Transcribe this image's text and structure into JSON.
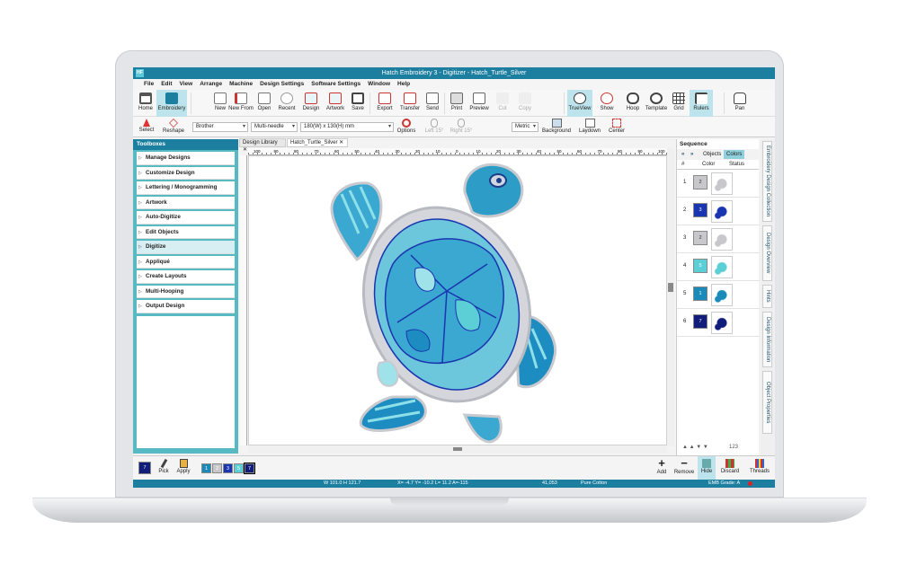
{
  "window": {
    "title": "Hatch Embroidery 3 - Digitizer - Hatch_Turtle_Silver",
    "logo": "HF"
  },
  "menu": [
    "File",
    "Edit",
    "View",
    "Arrange",
    "Machine",
    "Design Settings",
    "Software Settings",
    "Window",
    "Help"
  ],
  "toolbar": {
    "home": "Home",
    "embroidery": "Embroidery",
    "new": "New",
    "new_from": "New From",
    "open": "Open",
    "recent": "Recent",
    "design": "Design",
    "artwork": "Artwork",
    "save": "Save",
    "export": "Export",
    "transfer": "Transfer",
    "send": "Send",
    "print": "Print",
    "preview": "Preview",
    "cut": "Cut",
    "copy": "Copy",
    "trueview": "TrueView",
    "show": "Show",
    "hoop": "Hoop",
    "template": "Template",
    "grid": "Grid",
    "rulers": "Rulers",
    "pan": "Pan"
  },
  "toolbar2": {
    "select": "Select",
    "reshape": "Reshape",
    "brand": "Brother",
    "needle": "Multi-needle",
    "hoop": "180(W) x 130(H) mm",
    "options": "Options",
    "left15": "Left 15°",
    "right15": "Right 15°",
    "units": "Metric",
    "background": "Background",
    "laydown": "Laydown",
    "center": "Center"
  },
  "toolboxes": {
    "title": "Toolboxes",
    "items": [
      "Manage Designs",
      "Customize Design",
      "Lettering / Monogramming",
      "Artwork",
      "Auto-Digitize",
      "Edit Objects",
      "Digitize",
      "Appliqué",
      "Create Layouts",
      "Multi-Hooping",
      "Output Design"
    ]
  },
  "tabs": [
    "Design Library",
    "Hatch_Turtle_Silver"
  ],
  "ruler_labels": [
    "100",
    "90",
    "80",
    "70",
    "60",
    "50",
    "40",
    "30",
    "20",
    "10",
    "0",
    "10",
    "20",
    "30",
    "40",
    "50",
    "60",
    "70",
    "80",
    "90",
    "100"
  ],
  "sequence": {
    "title": "Sequence",
    "tab_objects": "Objects",
    "tab_colors": "Colors",
    "col_num": "#",
    "col_color": "Color",
    "col_status": "Status",
    "rows": [
      {
        "n": "1",
        "c": "2",
        "hex": "#c8c8cc"
      },
      {
        "n": "2",
        "c": "3",
        "hex": "#1a35b0"
      },
      {
        "n": "3",
        "c": "2",
        "hex": "#c8c8cc"
      },
      {
        "n": "4",
        "c": "5",
        "hex": "#5ccfd6"
      },
      {
        "n": "5",
        "c": "1",
        "hex": "#1a8ab8"
      },
      {
        "n": "6",
        "c": "7",
        "hex": "#101d7a"
      }
    ],
    "footer_num": "123"
  },
  "side_tabs": [
    "Embroidery Design Collection",
    "Design Overview",
    "Hints",
    "Design Information",
    "Object Properties"
  ],
  "bottom": {
    "current": "7",
    "pick": "Pick",
    "apply": "Apply",
    "palette": [
      {
        "n": "1",
        "hex": "#1a8ab8"
      },
      {
        "n": "2",
        "hex": "#c8c8cc"
      },
      {
        "n": "3",
        "hex": "#1a35b0"
      },
      {
        "n": "5",
        "hex": "#5ccfd6"
      },
      {
        "n": "7",
        "hex": "#101d7a"
      }
    ],
    "add": "Add",
    "remove": "Remove",
    "hide": "Hide",
    "discard": "Discard",
    "threads": "Threads"
  },
  "status": {
    "size": "W 101.0 H 121.7",
    "coords": "X= -4.7 Y= -10.2 L= 11.2 A=-115",
    "stitches": "41,053",
    "fabric": "Pure Cotton",
    "grade": "EMB Grade: A"
  }
}
